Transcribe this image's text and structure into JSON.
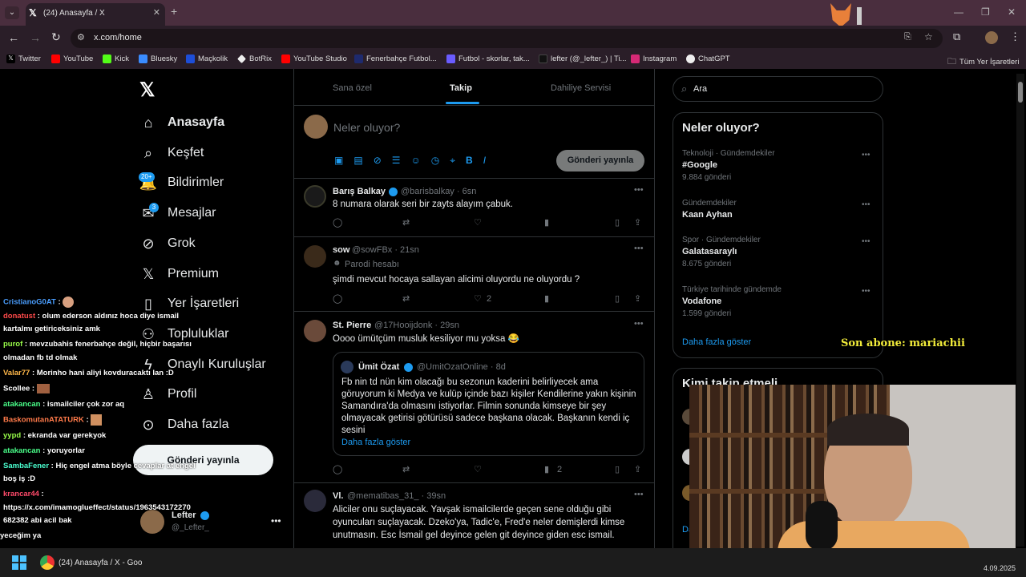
{
  "browser": {
    "tab_title": "(24) Anasayfa / X",
    "url": "x.com/home",
    "bookmarks": [
      "Twitter",
      "YouTube",
      "Kick",
      "Bluesky",
      "Maçkolik",
      "BotRix",
      "YouTube Studio",
      "Fenerbahçe Futbol...",
      "Futbol - skorlar, tak...",
      "lefter (@_lefter_) | Ti...",
      "Instagram",
      "ChatGPT"
    ],
    "all_bookmarks": "Tüm Yer İşaretleri"
  },
  "nav": {
    "items": [
      "Anasayfa",
      "Keşfet",
      "Bildirimler",
      "Mesajlar",
      "Grok",
      "Premium",
      "Yer İşaretleri",
      "Topluluklar",
      "Onaylı Kuruluşlar",
      "Profil",
      "Daha fazla"
    ],
    "notif_badge": "20+",
    "msg_badge": "3",
    "post_button": "Gönderi yayınla",
    "user_name": "Lefter",
    "user_handle": "@_Lefter_"
  },
  "tabs": {
    "t1": "Sana özel",
    "t2": "Takip",
    "t3": "Dahiliye Servisi"
  },
  "compose": {
    "placeholder": "Neler oluyor?",
    "post_button": "Gönderi yayınla"
  },
  "tweets": [
    {
      "name": "Barış Balkay",
      "handle": "@barisbalkay · 6sn",
      "text": "8 numara olarak seri bir zayts alayım çabuk."
    },
    {
      "name": "sow",
      "handle": "@sowFBx · 21sn",
      "label": "Parodi hesabı",
      "text": "şimdi mevcut hocaya sallayan alicimi oluyordu ne oluyordu ?",
      "likes": "2"
    },
    {
      "name": "St. Pierre",
      "handle": "@17Hooijdonk · 29sn",
      "text": "Oooo ümütçüm musluk kesiliyor mu yoksa 😂",
      "views": "2",
      "quote": {
        "name": "Ümit Özat",
        "handle": "@UmitOzatOnline · 8d",
        "text": "Fb nin td nün kim olacağı bu sezonun kaderini belirliyecek ama göruyorum ki Medya ve kulüp içinde bazı kişiler Kendilerine yakın kişinin Samandıra'da olmasını istiyorlar. Filmin sonunda kimseye bir şey olmayacak getirisi götürüsü sadece başkana olacak. Başkanın kendi iç sesini",
        "more": "Daha fazla göster"
      }
    },
    {
      "name": "Vl.",
      "handle": "@mematibas_31_ · 39sn",
      "text": "Aliciler onu suçlayacak. Yavşak ismailcilerde geçen sene olduğu gibi oyuncuları suçlayacak. Dzeko'ya, Tadic'e, Fred'e neler demişlerdi kimse unutmasın. Esc İsmail gel deyince gelen git deyince giden esc ismail."
    }
  ],
  "search": {
    "placeholder": "Ara"
  },
  "trends": {
    "title": "Neler oluyor?",
    "items": [
      {
        "meta": "Teknoloji · Gündemdekiler",
        "name": "#Google",
        "count": "9.884 gönderi"
      },
      {
        "meta": "Gündemdekiler",
        "name": "Kaan Ayhan",
        "count": ""
      },
      {
        "meta": "Spor · Gündemdekiler",
        "name": "Galatasaraylı",
        "count": "8.675 gönderi"
      },
      {
        "meta": "Türkiye tarihinde gündemde",
        "name": "Vodafone",
        "count": "1.599 gönderi"
      }
    ],
    "more": "Daha fazla göster"
  },
  "who_to_follow": {
    "title": "Kimi takip etmeli"
  },
  "overlay": {
    "last_sub": "Son abone: mariachii"
  },
  "chat": [
    {
      "user": "CristianoG0AT",
      "color": "#4a9eff",
      "text": ":"
    },
    {
      "user": "donatust",
      "color": "#ff4a4a",
      "text": ": olum ederson aldınız hoca diye ismail"
    },
    {
      "user": "",
      "color": "#fff",
      "text": "kartalmı getiriceksiniz amk"
    },
    {
      "user": "purof",
      "color": "#9aff4a",
      "text": ": mevzubahis fenerbahçe değil, hiçbir başarısı"
    },
    {
      "user": "",
      "color": "#fff",
      "text": "olmadan fb td olmak"
    },
    {
      "user": "Valar77",
      "color": "#ffb84a",
      "text": ": Morinho hani aliyi kovduracaktı lan :D"
    },
    {
      "user": "Scollee",
      "color": "#fff",
      "text": ":"
    },
    {
      "user": "atakancan",
      "color": "#4aff8a",
      "text": ": ismailciler çok zor aq"
    },
    {
      "user": "BaskomutanATATURK",
      "color": "#ff7a4a",
      "text": ":"
    },
    {
      "user": "yypd",
      "color": "#9aff4a",
      "text": ": ekranda var gerekyok"
    },
    {
      "user": "atakancan",
      "color": "#4aff8a",
      "text": ": yoruyorlar"
    },
    {
      "user": "SambaFener",
      "color": "#4affd0",
      "text": ": Hiç engel atma böyle cevaplar at engel"
    },
    {
      "user": "",
      "color": "#fff",
      "text": "boş iş :D"
    },
    {
      "user": "krancar44",
      "color": "#ff4a6a",
      "text": ":"
    },
    {
      "user": "",
      "color": "#fff",
      "text": "https://x.com/imamoglueffect/status/1963543172270"
    },
    {
      "user": "",
      "color": "#fff",
      "text": "682382 abi acil bak"
    },
    {
      "user": "",
      "color": "#fff",
      "text": "yeceğim ya"
    }
  ],
  "taskbar": {
    "app": "(24) Anasayfa / X - Goo",
    "date": "4.09.2025"
  }
}
